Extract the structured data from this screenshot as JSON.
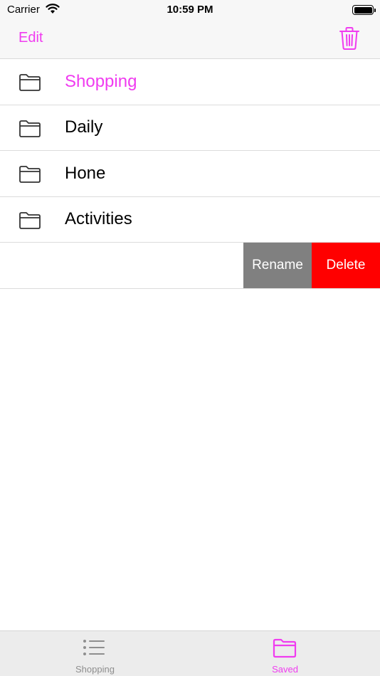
{
  "status_bar": {
    "carrier": "Carrier",
    "time": "10:59 PM"
  },
  "nav": {
    "edit_label": "Edit",
    "trash_icon": "trash-icon"
  },
  "colors": {
    "accent": "#f03cf0",
    "rename_bg": "#808080",
    "delete_bg": "#ff0000"
  },
  "folders": [
    {
      "label": "Shopping",
      "icon": "folder-icon",
      "selected": true
    },
    {
      "label": "Daily",
      "icon": "folder-icon",
      "selected": false
    },
    {
      "label": "Hone",
      "icon": "folder-icon",
      "selected": false
    },
    {
      "label": "Activities",
      "icon": "folder-icon",
      "selected": false
    }
  ],
  "swipe_actions": {
    "rename_label": "Rename",
    "delete_label": "Delete"
  },
  "tab_bar": {
    "tabs": [
      {
        "label": "Shopping",
        "icon": "list-icon",
        "active": false
      },
      {
        "label": "Saved",
        "icon": "folder-icon",
        "active": true
      }
    ]
  }
}
